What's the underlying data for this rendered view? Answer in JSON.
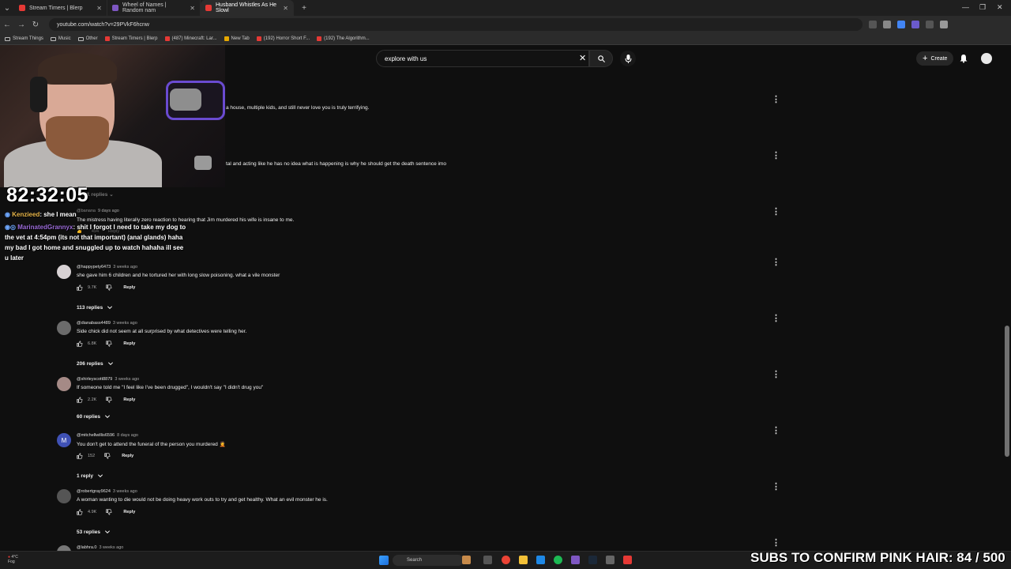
{
  "browser": {
    "tabs": [
      {
        "title": "Stream Timers | Blerp",
        "color": "#e53935"
      },
      {
        "title": "Wheel of Names | Random nam",
        "color": "#7e57c2"
      },
      {
        "title": "Husband Whistles As He Slowl",
        "color": "#e53935"
      }
    ],
    "url": "youtube.com/watch?v=29PVkF6hcnw",
    "bookmarks": [
      "Stream Things",
      "Music",
      "Other",
      "Stream Timers | Blerp",
      "(487) Minecraft: Lar...",
      "New Tab",
      "(192) Horror Short F...",
      "(192) The Algorithm..."
    ]
  },
  "youtube": {
    "search_value": "explore with us",
    "create_label": "Create"
  },
  "overlay": {
    "timer": "82:32:05",
    "chat": [
      {
        "name": "Kenzieed",
        "text": ": she I mean"
      },
      {
        "name": "MarinatedGrannyx",
        "text": ": shit I forgot I need to take my dog to the vet at 4:54pm (its not that important) (anal glands) haha my bad I got home and snuggled up to watch hahaha ill see u later"
      }
    ],
    "subs_goal": "SUBS TO CONFIRM PINK HAIR: 84 / 500"
  },
  "partial_comments": [
    {
      "text": "a house, multiple kids, and still never love you is truly terrifying."
    },
    {
      "text": "tal and acting like he has no idea what is happening is why he should get the death sentence imo"
    }
  ],
  "hidden_comment": {
    "replies_label": "1 replies",
    "handle": "@banana",
    "time": "9 days ago",
    "text": "The mistress having literally zero reaction to hearing that Jim murdered his wife is insane to me.",
    "likes": "494",
    "reply_label": "Reply"
  },
  "comments": [
    {
      "handle": "@happypety6473",
      "time": "3 weeks ago",
      "text": "she gave him 6 children and he tortured her with long slow poisoning. what a vile monster",
      "likes": "9.7K",
      "reply_label": "Reply",
      "replies": "113 replies",
      "avatar_color": "#d8d2d4",
      "initial": ""
    },
    {
      "handle": "@dianabass4489",
      "time": "3 weeks ago",
      "text": "Side chick did not seem at all surprised by what detectives were telling her.",
      "likes": "6.8K",
      "reply_label": "Reply",
      "replies": "206 replies",
      "avatar_color": "#6b6b6b",
      "initial": ""
    },
    {
      "handle": "@shirleyscott8879",
      "time": "3 weeks ago",
      "text": "If someone told me \"I feel like I've been drugged\", I wouldn't say \"I didn't drug you\"",
      "likes": "2.2K",
      "reply_label": "Reply",
      "replies": "60 replies",
      "avatar_color": "#a58a86",
      "initial": ""
    },
    {
      "handle": "@mitchellwillis6596",
      "time": "8 days ago",
      "text": "You don't get to attend the funeral of the person you murdered 🤦",
      "likes": "152",
      "reply_label": "Reply",
      "replies": "1 reply",
      "avatar_color": "#3f51b5",
      "initial": "M"
    },
    {
      "handle": "@robertgray9624",
      "time": "3 weeks ago",
      "text": "A woman wanting to die would not be doing heavy work outs to try and get healthy. What an evil monster he is.",
      "likes": "4.9K",
      "reply_label": "Reply",
      "replies": "53 replies",
      "avatar_color": "#555555",
      "initial": ""
    },
    {
      "handle": "@labhra.0",
      "time": "3 weeks ago",
      "text": "",
      "likes": "",
      "reply_label": "",
      "replies": "",
      "avatar_color": "#777777",
      "initial": ""
    }
  ],
  "taskbar": {
    "weather_temp": "4°C",
    "weather_desc": "Fog",
    "search_label": "Search"
  },
  "icons": [
    "close-icon",
    "search-icon",
    "mic-icon",
    "plus-icon",
    "bell-icon",
    "thumbs-up-icon",
    "thumbs-down-icon",
    "chevron-down-icon",
    "more-vert-icon"
  ]
}
